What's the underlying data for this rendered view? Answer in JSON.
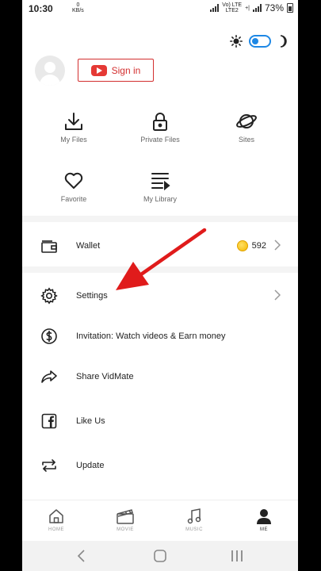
{
  "status_bar": {
    "time": "10:30",
    "speed_value": "0",
    "speed_unit": "KB/s",
    "network_line1": "Vo) LTE",
    "network_line2": "LTE2",
    "network_tag": "+|",
    "battery": "73%"
  },
  "profile": {
    "signin_label": "Sign in"
  },
  "quick_actions": [
    {
      "label": "My Files",
      "icon": "download-icon"
    },
    {
      "label": "Private Files",
      "icon": "lock-icon"
    },
    {
      "label": "Sites",
      "icon": "planet-icon"
    },
    {
      "label": "Favorite",
      "icon": "heart-icon"
    },
    {
      "label": "My Library",
      "icon": "playlist-icon"
    }
  ],
  "wallet": {
    "label": "Wallet",
    "amount": "592"
  },
  "menu": [
    {
      "label": "Settings",
      "icon": "gear-icon"
    },
    {
      "label": "Invitation: Watch videos & Earn money",
      "icon": "dollar-icon"
    },
    {
      "label": "Share VidMate",
      "icon": "share-icon"
    },
    {
      "label": "Like Us",
      "icon": "facebook-icon"
    },
    {
      "label": "Update",
      "icon": "update-icon"
    }
  ],
  "bottom_nav": [
    {
      "label": "HOME",
      "icon": "home-icon"
    },
    {
      "label": "MOVIE",
      "icon": "movie-icon"
    },
    {
      "label": "MUSIC",
      "icon": "music-icon"
    },
    {
      "label": "ME",
      "icon": "person-icon",
      "active": true
    }
  ],
  "colors": {
    "brand_red": "#d32f2f",
    "toggle_blue": "#1e88e5",
    "coin_gold": "#f5b800"
  }
}
